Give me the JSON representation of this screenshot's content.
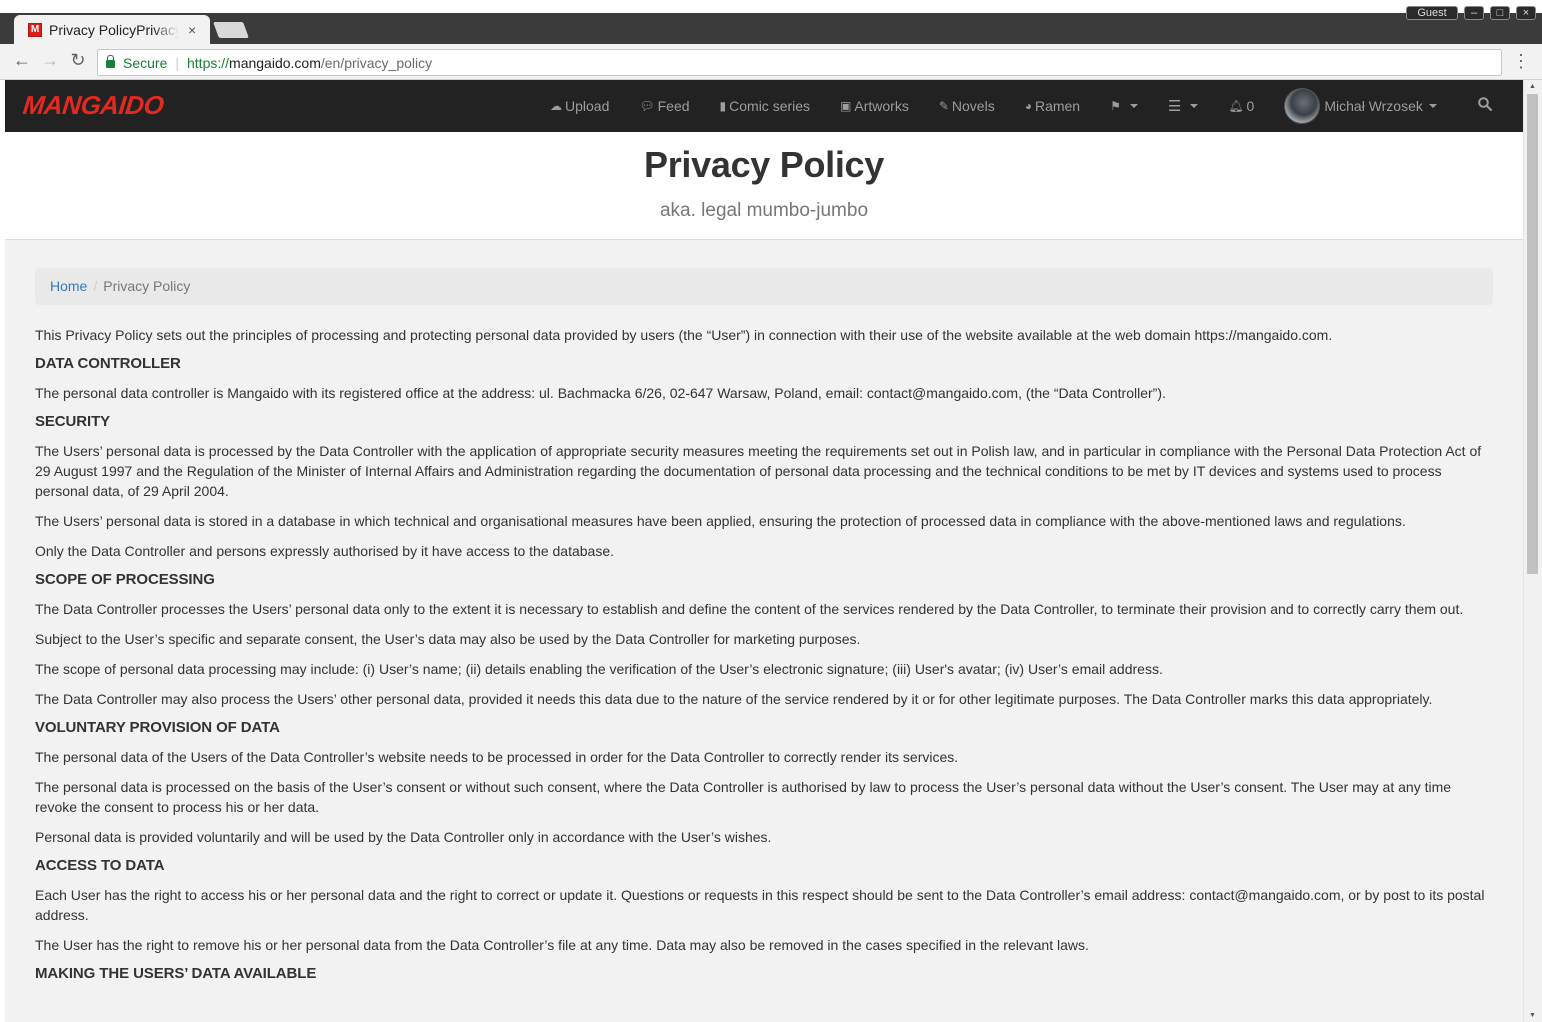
{
  "browser": {
    "tab_title": "Privacy PolicyPrivacy Policy",
    "tab_close": "×",
    "favicon_letter": "M",
    "guest_label": "Guest",
    "url_secure": "Secure",
    "url_scheme": "https://",
    "url_host": "mangaido.com",
    "url_path": "/en/privacy_policy",
    "back_icon": "arrow-left-icon",
    "forward_icon": "arrow-right-icon",
    "reload_icon": "reload-icon"
  },
  "site": {
    "logo": "MANGAIDO",
    "brand_color": "#e22a21",
    "nav": {
      "upload": "Upload",
      "feed": "Feed",
      "comic_series": "Comic series",
      "artworks": "Artworks",
      "novels": "Novels",
      "ramen": "Ramen",
      "notifications_count": "0",
      "user_name": "Michał Wrzosek"
    }
  },
  "hero": {
    "title": "Privacy Policy",
    "subtitle": "aka. legal mumbo-jumbo"
  },
  "breadcrumb": {
    "home": "Home",
    "current": "Privacy Policy"
  },
  "policy": {
    "intro": "This Privacy Policy sets out the principles of processing and protecting personal data provided by users (the “User”) in connection with their use of the website available at the web domain https://mangaido.com.",
    "data_controller_heading": "DATA CONTROLLER",
    "data_controller_p1": "The personal data controller is Mangaido with its registered office at the address: ul. Bachmacka 6/26, 02-647 Warsaw, Poland, email: contact@mangaido.com, (the “Data Controller”).",
    "security_heading": "SECURITY",
    "security_p1": "The Users’ personal data is processed by the Data Controller with the application of appropriate security measures meeting the requirements set out in Polish law, and in particular in compliance with the Personal Data Protection Act of 29 August 1997 and the Regulation of the Minister of Internal Affairs and Administration regarding the documentation of personal data processing and the technical conditions to be met by IT devices and systems used to process personal data, of 29 April 2004.",
    "security_p2": "The Users’ personal data is stored in a database in which technical and organisational measures have been applied, ensuring the protection of processed data in compliance with the above-mentioned laws and regulations.",
    "security_p3": "Only the Data Controller and persons expressly authorised by it have access to the database.",
    "scope_heading": "SCOPE OF PROCESSING",
    "scope_p1": "The Data Controller processes the Users’ personal data only to the extent it is necessary to establish and define the content of the services rendered by the Data Controller, to terminate their provision and to correctly carry them out.",
    "scope_p2": "Subject to the User’s specific and separate consent, the User’s data may also be used by the Data Controller for marketing purposes.",
    "scope_p3": "The scope of personal data processing may include: (i) User’s name; (ii) details enabling the verification of the User’s electronic signature; (iii) User's avatar; (iv) User’s email address.",
    "scope_p4": "The Data Controller may also process the Users’ other personal data, provided it needs this data due to the nature of the service rendered by it or for other legitimate purposes. The Data Controller marks this data appropriately.",
    "voluntary_heading": "VOLUNTARY PROVISION OF DATA",
    "voluntary_p1": "The personal data of the Users of the Data Controller’s website needs to be processed in order for the Data Controller to correctly render its services.",
    "voluntary_p2": "The personal data is processed on the basis of the User’s consent or without such consent, where the Data Controller is authorised by law to process the User’s personal data without the User’s consent. The User may at any time revoke the consent to process his or her data.",
    "voluntary_p3": "Personal data is provided voluntarily and will be used by the Data Controller only in accordance with the User’s wishes.",
    "access_heading": "ACCESS TO DATA",
    "access_p1": "Each User has the right to access his or her personal data and the right to correct or update it. Questions or requests in this respect should be sent to the Data Controller’s email address: contact@mangaido.com, or by post to its postal address.",
    "access_p2": "The User has the right to remove his or her personal data from the Data Controller’s file at any time. Data may also be removed in the cases specified in the relevant laws.",
    "available_heading": "MAKING THE USERS’ DATA AVAILABLE"
  }
}
